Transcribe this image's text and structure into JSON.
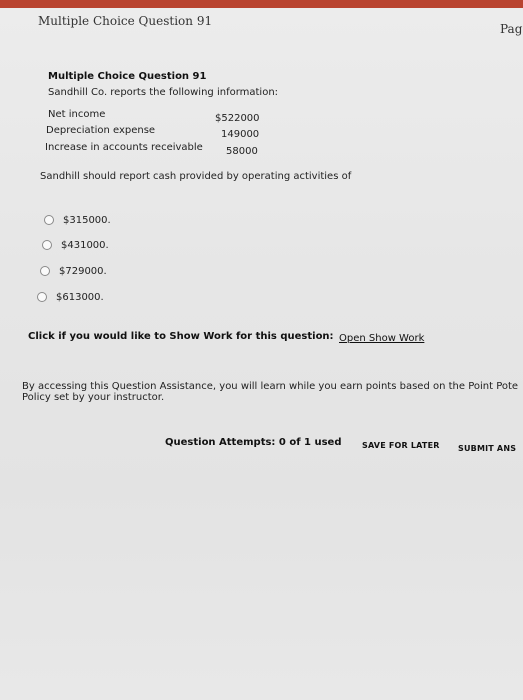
{
  "header": {
    "title": "Multiple Choice Question 91",
    "page_label": "Page"
  },
  "question": {
    "title": "Multiple Choice Question 91",
    "intro": "Sandhill Co. reports the following information:",
    "items": [
      {
        "label": "Net income",
        "value": "$522000"
      },
      {
        "label": "Depreciation expense",
        "value": "149000"
      },
      {
        "label": "Increase in accounts receivable",
        "value": "58000"
      }
    ],
    "prompt": "Sandhill should report cash provided by operating activities of",
    "options": [
      "$315000.",
      "$431000.",
      "$729000.",
      "$613000."
    ],
    "selected_option": null
  },
  "show_work": {
    "prompt": "Click if you would like to Show Work for this question:",
    "link_label": "Open Show Work"
  },
  "assistance": {
    "text": "By accessing this Question Assistance, you will learn while you earn points based on the Point Pote Policy set by your instructor."
  },
  "footer": {
    "attempts": "Question Attempts: 0 of 1 used",
    "save_label": "SAVE FOR LATER",
    "submit_label": "SUBMIT ANS"
  }
}
